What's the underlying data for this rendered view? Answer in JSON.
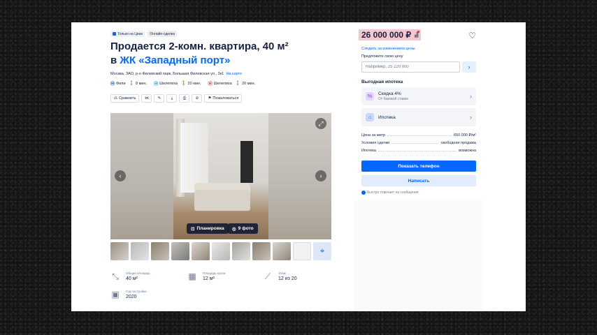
{
  "badges": {
    "owner": "Только на Циан",
    "online": "Онлайн-сделка"
  },
  "title": {
    "line1": "Продается 2-комн. квартира, 40 м²",
    "prefix": "в ",
    "complex": "ЖК «Западный порт»"
  },
  "address": {
    "text": "Москва, ЗАО, р-н Филевский парк, Большая Филевская ул., 3к1",
    "map_link": "На карте"
  },
  "metro": [
    {
      "name": "Фили",
      "time": "8 мин."
    },
    {
      "name": "Шелепиха",
      "time": "20 мин."
    },
    {
      "name": "Шелепиха",
      "time": "20 мин."
    }
  ],
  "toolbar": {
    "compare": "Сравнить",
    "complain": "Пожаловаться"
  },
  "gallery": {
    "plan": "Планировка",
    "photos": "9 фото"
  },
  "facts": [
    {
      "label": "Общая площадь",
      "value": "40 м²"
    },
    {
      "label": "Площадь кухни",
      "value": "12 м²"
    },
    {
      "label": "Этаж",
      "value": "12 из 20"
    },
    {
      "label": "Год постройки",
      "value": "2020"
    }
  ],
  "sidebar": {
    "price": "26 000 000 ₽",
    "follow": "Следить за изменением цены",
    "offer_label": "Предложите свою цену",
    "offer_placeholder": "Например, 25 220 000",
    "mortgage_title": "Выгодная ипотека",
    "mortgage_items": [
      {
        "name": "Скидка 4%",
        "sub": "От базовой ставки"
      },
      {
        "name": "Ипотека",
        "sub": ""
      }
    ],
    "terms": [
      {
        "k": "Цена за метр",
        "v": "650 000 ₽/м²"
      },
      {
        "k": "Условия сделки",
        "v": "свободная продажа"
      },
      {
        "k": "Ипотека",
        "v": "возможна"
      }
    ],
    "phone_button": "Показать телефон",
    "write_button": "Написать",
    "reply_note": "Быстро отвечает на сообщения"
  },
  "colors": {
    "accent": "#0468ff",
    "price_highlight": "#f8c7cc",
    "text": "#152242"
  }
}
